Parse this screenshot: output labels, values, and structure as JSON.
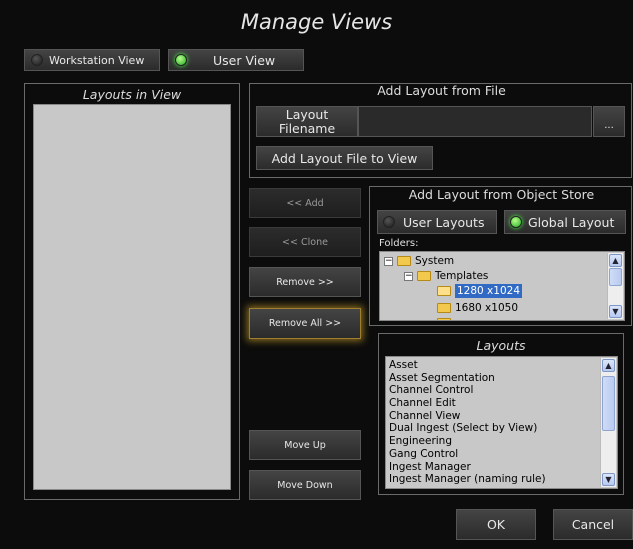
{
  "dialog": {
    "title": "Manage Views"
  },
  "view_toggle": {
    "workstation_label": "Workstation View",
    "user_label": "User View"
  },
  "layouts_in_view": {
    "header": "Layouts in View"
  },
  "add_from_file": {
    "header": "Add Layout from File",
    "filename_label": "Layout Filename",
    "filename_value": "",
    "browse_label": "...",
    "add_file_label": "Add Layout File to View"
  },
  "actions": {
    "add": "<< Add",
    "clone": "<< Clone",
    "remove": "Remove >>",
    "remove_all": "Remove All >>",
    "move_up": "Move Up",
    "move_down": "Move Down"
  },
  "object_store": {
    "header": "Add Layout from Object Store",
    "user_layouts_label": "User Layouts",
    "global_layouts_label": "Global Layout",
    "folders_label": "Folders:",
    "tree": {
      "root": "System",
      "child": "Templates",
      "selected": "1280 x1024",
      "next": "1680 x1050"
    },
    "layouts_header": "Layouts",
    "layouts": [
      "Asset",
      "Asset Segmentation",
      "Channel Control",
      "Channel Edit",
      "Channel View",
      "Dual Ingest (Select by View)",
      "Engineering",
      "Gang Control",
      "Ingest Manager",
      "Ingest Manager (naming rule)"
    ]
  },
  "footer": {
    "ok": "OK",
    "cancel": "Cancel"
  },
  "colors": {
    "led_on": "#2ecc2e",
    "led_off": "#333333",
    "selection": "#316ac5",
    "focus_glow": "#c8a028"
  }
}
